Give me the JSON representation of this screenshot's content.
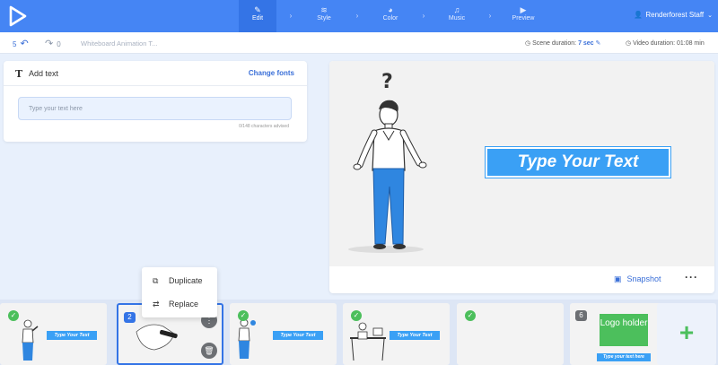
{
  "topbar": {
    "steps": [
      {
        "label": "Edit",
        "icon": "pencil-icon"
      },
      {
        "label": "Style",
        "icon": "layers-icon"
      },
      {
        "label": "Color",
        "icon": "palette-icon"
      },
      {
        "label": "Music",
        "icon": "music-note-icon"
      },
      {
        "label": "Preview",
        "icon": "play-icon"
      }
    ],
    "user_name": "Renderforest Staff"
  },
  "subbar": {
    "undo_count": "5",
    "redo_count": "0",
    "project_title": "Whiteboard Animation T...",
    "scene_duration_label": "Scene duration:",
    "scene_duration_value": "7 sec",
    "video_duration": "Video duration: 01:08 min"
  },
  "text_panel": {
    "title": "Add text",
    "change_fonts": "Change fonts",
    "input_placeholder": "Type your text here",
    "char_hint": "0/148 characters advised"
  },
  "preview": {
    "overlay_text": "Type Your Text",
    "snapshot_label": "Snapshot"
  },
  "context_menu": {
    "duplicate": "Duplicate",
    "replace": "Replace"
  },
  "scenes": [
    {
      "badge": "check",
      "text": "Type Your Text"
    },
    {
      "badge": "2"
    },
    {
      "badge": "check",
      "text": "Type Your Text"
    },
    {
      "badge": "check",
      "text": "Type Your Text"
    },
    {
      "badge": "check"
    },
    {
      "badge": "6",
      "logo_text": "Logo holder",
      "sub_text": "Type your text here"
    }
  ],
  "colors": {
    "primary": "#4585f4",
    "accent_blue": "#3aa0f5",
    "success_green": "#4cbf5c"
  }
}
